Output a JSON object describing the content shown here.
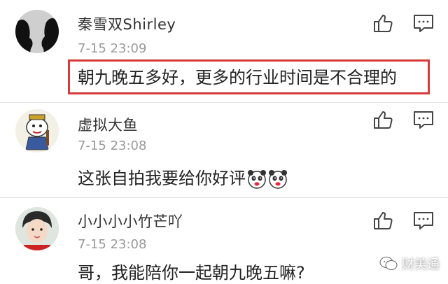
{
  "comments": [
    {
      "username": "秦雪双Shirley",
      "timestamp": "7-15 23:09",
      "content": "朝九晚五多好，更多的行业时间是不合理的",
      "highlighted": true
    },
    {
      "username": "虚拟大鱼",
      "timestamp": "7-15 23:08",
      "content": "这张自拍我要给你好评",
      "emojis": [
        "panda-face-icon",
        "panda-face-icon"
      ]
    },
    {
      "username": "小小小小竹芒吖",
      "timestamp": "7-15 23:08",
      "content": "哥，我能陪你一起朝九晚五嘛?"
    }
  ],
  "icons": {
    "like": "thumbs-up-icon",
    "reply": "comment-icon"
  },
  "watermark": {
    "label": "财美通",
    "icon": "wechat-icon"
  },
  "colors": {
    "highlight_border": "#d63a3a",
    "timestamp": "#999999",
    "username": "#333333"
  }
}
